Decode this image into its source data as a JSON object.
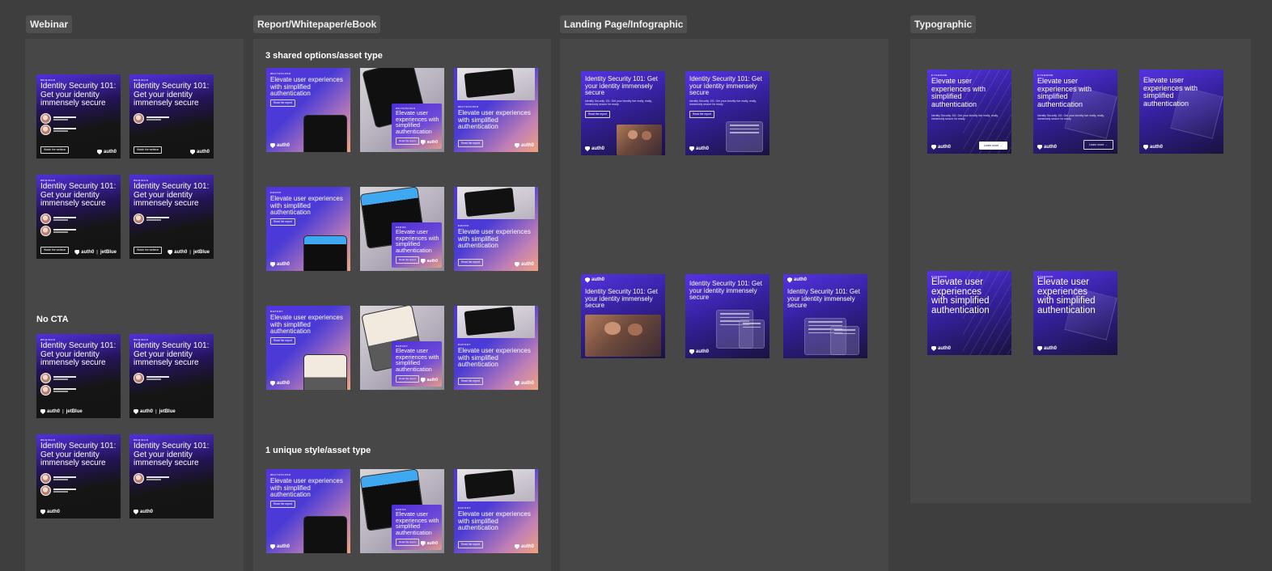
{
  "sections": {
    "webinar": {
      "label": "Webinar",
      "no_cta": "No CTA"
    },
    "report": {
      "label": "Report/Whitepaper/eBook",
      "shared": "3 shared options/asset type",
      "unique": "1 unique style/asset type"
    },
    "landing": {
      "label": "Landing Page/Infographic"
    },
    "typographic": {
      "label": "Typographic"
    }
  },
  "ads": {
    "webinar_eyebrow": "WEBINAR",
    "webinar_headline": "Identity Security 101: Get your identity immensely secure",
    "speaker1_name": "Samantha Murphy",
    "speaker1_role": "CEO",
    "speaker2_name": "Johnny Baskerville",
    "speaker2_role": "VP of Product",
    "cta_webinar": "Watch the webinar",
    "cta_report": "Read the report",
    "cta_learn": "Learn more →",
    "brand": "auth0",
    "partner": "jetBlue",
    "elevate_headline": "Elevate user experiences with simplified authentication",
    "whitepaper_eyebrow": "WHITEPAPER",
    "ebook_eyebrow": "EBOOK",
    "report_eyebrow": "REPORT",
    "eyebrow_typo": "EYEBROW",
    "landing_body": "Identity Security 101: Get your identity live really, really, immensely secure for ready",
    "typo_body": "Identity Security 101: Get your identity live really, really, immensely secure for ready"
  },
  "colors": {
    "canvas": "#3e3e3e",
    "frame": "#474747",
    "label_bg": "#4f4f4f",
    "brand_purple": "#4d2ad8",
    "accent_peach": "#f0a27e"
  }
}
